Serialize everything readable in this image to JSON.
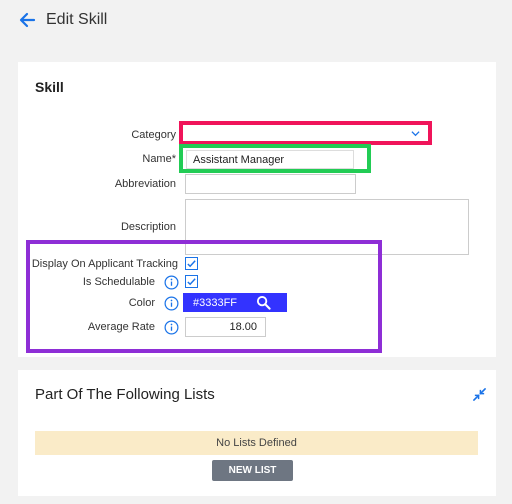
{
  "header": {
    "title": "Edit Skill"
  },
  "skill_card": {
    "title": "Skill",
    "category_label": "Category",
    "category_value": "",
    "name_label": "Name*",
    "name_value": "Assistant Manager",
    "abbreviation_label": "Abbreviation",
    "abbreviation_value": "",
    "description_label": "Description",
    "description_value": "",
    "display_label": "Display On Applicant Tracking",
    "display_checked": true,
    "schedulable_label": "Is Schedulable",
    "schedulable_checked": true,
    "color_label": "Color",
    "color_value": "#3333FF",
    "rate_label": "Average Rate",
    "rate_value": "18.00"
  },
  "lists_card": {
    "title": "Part Of The Following Lists",
    "empty_text": "No Lists Defined",
    "new_list_label": "NEW LIST"
  },
  "colors": {
    "accent": "#1a73e8",
    "highlight_red": "#f0145a",
    "highlight_green": "#22cc55",
    "highlight_purple": "#8e2ed6",
    "swatch": "#3333ff"
  }
}
